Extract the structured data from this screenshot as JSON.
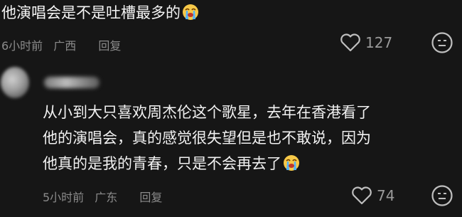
{
  "comments": [
    {
      "text": "他演唱会是不是吐槽最多的",
      "emoji": "crying-face-emoji",
      "time": "6小时前",
      "location": "广西",
      "reply_label": "回复",
      "likes": "127"
    },
    {
      "lines": [
        "从小到大只喜欢周杰伦这个歌星，去年在香港看了",
        "他的演唱会，真的感觉很失望但是也不敢说，因为",
        "他真的是我的青春，只是不会再去了"
      ],
      "emoji": "crying-face-emoji",
      "time": "5小时前",
      "location": "广东",
      "reply_label": "回复",
      "likes": "74"
    }
  ],
  "colors": {
    "background": "#161616",
    "text": "#f2f2f2",
    "meta": "#8b8b8b"
  }
}
